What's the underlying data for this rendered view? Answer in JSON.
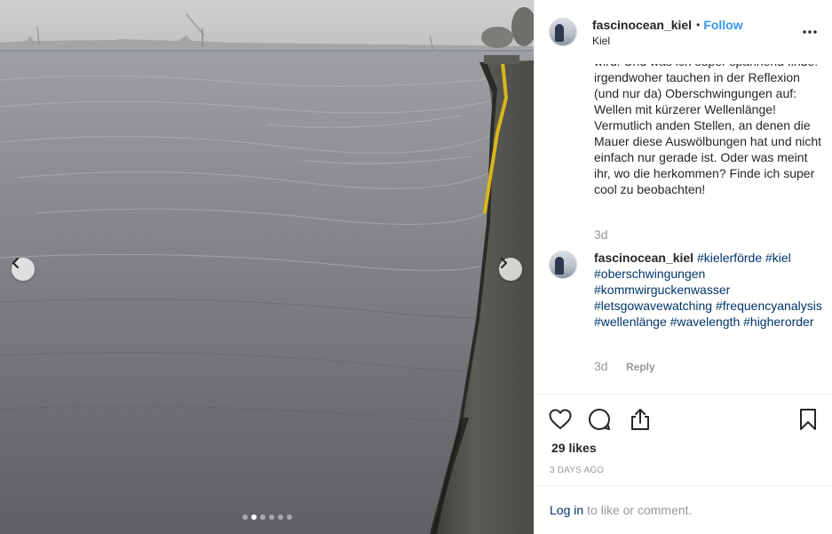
{
  "post": {
    "username": "fascinocean_kiel",
    "separator": "•",
    "follow_label": "Follow",
    "location": "Kiel",
    "carousel": {
      "slide_count": 6,
      "active_slide": 2
    }
  },
  "comments": {
    "caption_tail": "wird. Und was ich super spannend finde: irgendwoher tauchen in der Reflexion (und nur da) Oberschwingungen auf: Wellen mit kürzerer Wellenlänge! Vermutlich anden Stellen, an denen die Mauer diese Auswölbungen hat und nicht einfach nur gerade ist. Oder was meint ihr, wo die herkommen? Finde ich super cool zu beobachten!",
    "caption_time": "3d",
    "hashtag_comment": {
      "username": "fascinocean_kiel",
      "text": "#kielerförde #kiel #oberschwingungen #kommwirguckenwasser #letsgowavewatching #frequencyanalysis #wellenlänge #wavelength #higherorder",
      "time": "3d",
      "reply_label": "Reply"
    }
  },
  "actions": {
    "likes": "29 likes",
    "posted_ago": "3 DAYS AGO"
  },
  "footer": {
    "login_label": "Log in",
    "login_suffix": "to like or comment."
  },
  "icons": {
    "prev": "chevron-left-icon",
    "next": "chevron-right-icon",
    "more": "more-options-icon",
    "like": "heart-icon",
    "comment": "comment-bubble-icon",
    "share": "share-icon",
    "save": "bookmark-icon"
  },
  "colors": {
    "link_blue": "#3897f0",
    "hashtag_navy": "#003569",
    "muted_gray": "#999999",
    "text_dark": "#262626"
  }
}
